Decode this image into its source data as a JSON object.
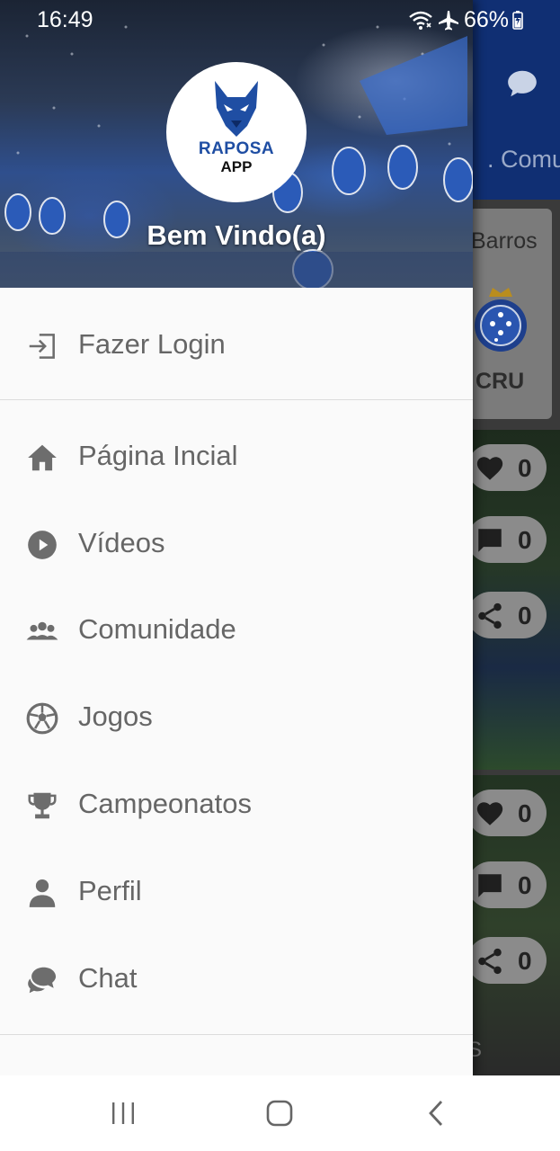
{
  "status_bar": {
    "time": "16:49",
    "battery": "66%",
    "icons": [
      "wifi-icon",
      "airplane-icon",
      "battery-icon"
    ]
  },
  "drawer": {
    "logo": {
      "line1": "RAPOSA",
      "line2": "APP"
    },
    "welcome": "Bem Vindo(a)",
    "login_item": {
      "label": "Fazer Login",
      "icon": "login-icon"
    },
    "items": [
      {
        "label": "Página Incial",
        "icon": "home-icon"
      },
      {
        "label": "Vídeos",
        "icon": "play-circle-icon"
      },
      {
        "label": "Comunidade",
        "icon": "group-icon"
      },
      {
        "label": "Jogos",
        "icon": "soccer-ball-icon"
      },
      {
        "label": "Campeonatos",
        "icon": "trophy-icon"
      },
      {
        "label": "Perfil",
        "icon": "person-icon"
      },
      {
        "label": "Chat",
        "icon": "chat-bubbles-icon"
      }
    ]
  },
  "background_app": {
    "tab_label": ". Comun",
    "card_name": "Barros",
    "team_abbr": "CRU",
    "crest_text": "CRUZEIRO ESPORTE CLUBE",
    "post1": {
      "likes": "0",
      "comments": "0",
      "shares": "0"
    },
    "post2": {
      "likes": "0",
      "comments": "0",
      "shares": "0"
    },
    "fragment": "S"
  },
  "colors": {
    "app_bar": "#102f73",
    "drawer_bg": "#fafafa",
    "menu_text": "#666666",
    "icon_gray": "#6d6d6d",
    "logo_blue": "#1f4ea3"
  },
  "nav_bar": {
    "buttons": [
      "recent-apps-icon",
      "home-button-icon",
      "back-icon"
    ]
  }
}
